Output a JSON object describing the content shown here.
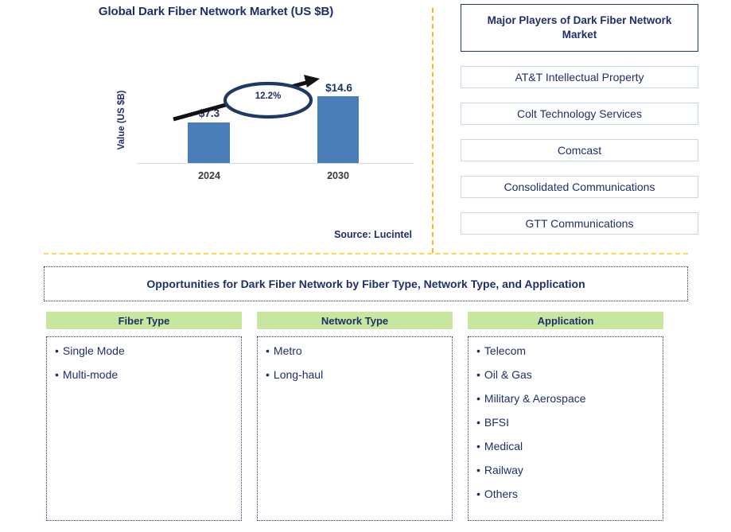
{
  "chart_panel": {
    "title": "Global Dark Fiber Network Market (US $B)",
    "source": "Source: Lucintel"
  },
  "chart_data": {
    "type": "bar",
    "title": "Global Dark Fiber Network Market (US $B)",
    "xlabel": "",
    "ylabel": "Value (US $B)",
    "categories": [
      "2024",
      "2030"
    ],
    "values": [
      7.3,
      14.6
    ],
    "value_labels": [
      "$7.3",
      "$14.6"
    ],
    "annotation": "12.2%",
    "annotation_type": "CAGR",
    "ylim": [
      0,
      16
    ],
    "grid": false,
    "legend": false,
    "bar_color": "#4A7EBB",
    "source": "Source: Lucintel"
  },
  "players": {
    "header": "Major Players of Dark Fiber Network Market",
    "items": [
      "AT&T Intellectual Property",
      "Colt Technology Services",
      "Comcast",
      "Consolidated Communications",
      "GTT Communications"
    ]
  },
  "opportunities": {
    "banner": "Opportunities for Dark Fiber Network by Fiber Type, Network Type, and Application",
    "columns": [
      {
        "header": "Fiber Type",
        "items": [
          "Single Mode",
          "Multi-mode"
        ]
      },
      {
        "header": "Network Type",
        "items": [
          "Metro",
          "Long-haul"
        ]
      },
      {
        "header": "Application",
        "items": [
          "Telecom",
          "Oil & Gas",
          "Military & Aerospace",
          "BFSI",
          "Medical",
          "Railway",
          "Others"
        ]
      }
    ]
  },
  "theme": {
    "navy": "#1F2F68",
    "bar_blue": "#4A7EBB",
    "header_green": "#C8E6A0",
    "divider_amber": "#F5B921",
    "box_border_blue": "#C5D9E8"
  }
}
